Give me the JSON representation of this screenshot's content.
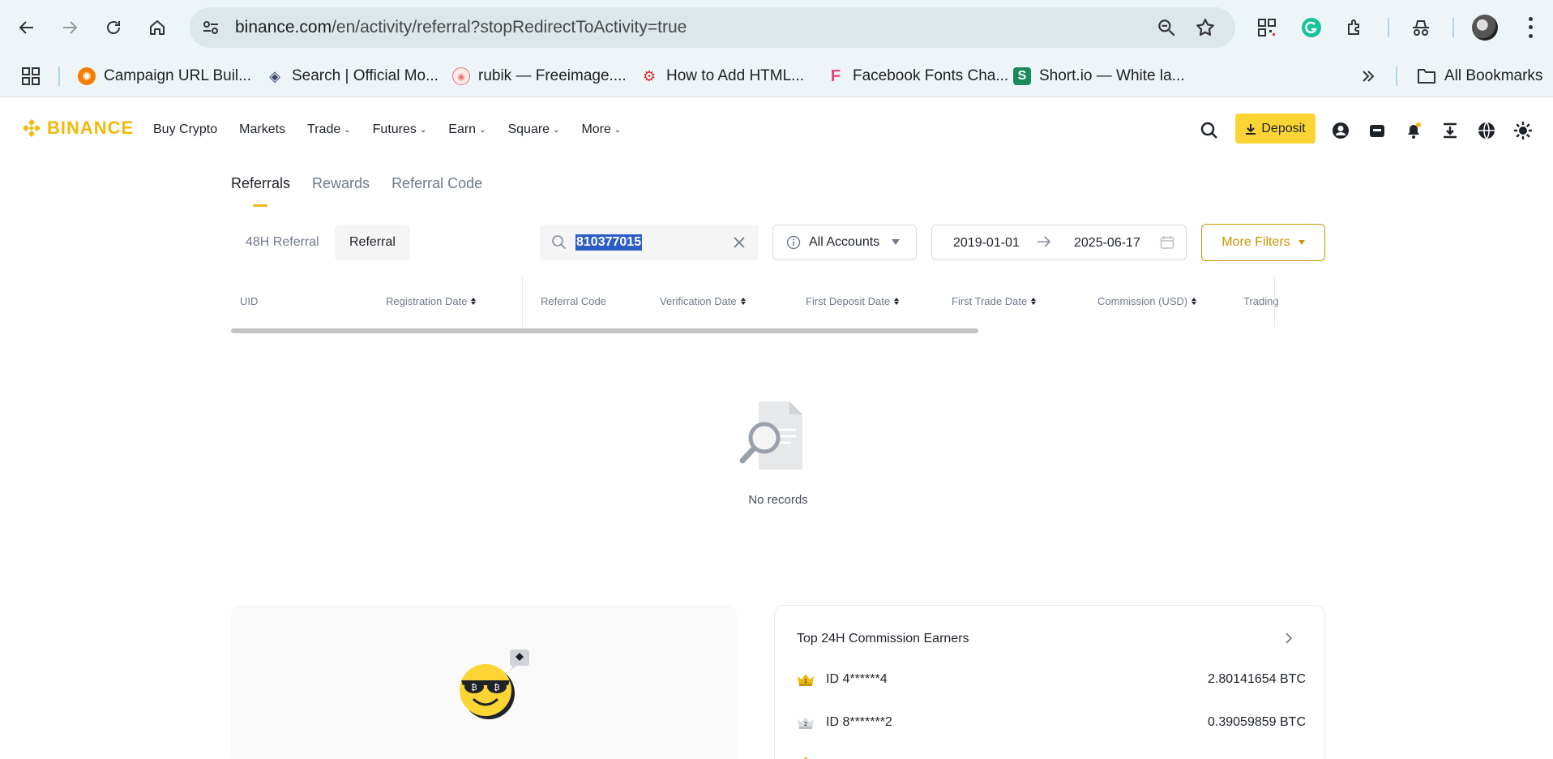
{
  "browser": {
    "url_host": "binance.com",
    "url_path": "/en/activity/referral?stopRedirectToActivity=true",
    "bookmarks": [
      {
        "label": "Campaign URL Buil...",
        "icon": "campaign-icon",
        "color": "#f57c00"
      },
      {
        "label": "Search | Official Mo...",
        "icon": "diamond-icon",
        "color": "#3c4a6e"
      },
      {
        "label": "rubik — Freeimage....",
        "icon": "rubik-icon",
        "color": "#e57373"
      },
      {
        "label": "How to Add HTML...",
        "icon": "gear-icon",
        "color": "#d32f2f"
      },
      {
        "label": "Facebook Fonts Cha...",
        "icon": "font-f-icon",
        "color": "#ec407a"
      },
      {
        "label": "Short.io — White la...",
        "icon": "short-s-icon",
        "color": "#1b8a5a"
      }
    ],
    "all_bookmarks_label": "All Bookmarks"
  },
  "header": {
    "logo_text": "BINANCE",
    "menu": [
      {
        "label": "Buy Crypto",
        "has_dropdown": false
      },
      {
        "label": "Markets",
        "has_dropdown": false
      },
      {
        "label": "Trade",
        "has_dropdown": true
      },
      {
        "label": "Futures",
        "has_dropdown": true
      },
      {
        "label": "Earn",
        "has_dropdown": true
      },
      {
        "label": "Square",
        "has_dropdown": true
      },
      {
        "label": "More",
        "has_dropdown": true
      }
    ],
    "deposit_label": "Deposit",
    "accent_color": "#fcd535",
    "brand_color": "#f0b90b"
  },
  "tabs": [
    {
      "label": "Referrals",
      "active": true
    },
    {
      "label": "Rewards",
      "active": false
    },
    {
      "label": "Referral Code",
      "active": false
    }
  ],
  "filters": {
    "seg_48h": "48H Referral",
    "seg_referral": "Referral",
    "search_value": "810377015",
    "account_select": "All Accounts",
    "date_from": "2019-01-01",
    "date_to": "2025-06-17",
    "more_filters_label": "More Filters"
  },
  "table": {
    "columns": [
      {
        "label": "UID",
        "sortable": false
      },
      {
        "label": "Registration Date",
        "sortable": true
      },
      {
        "label": "Referral Code",
        "sortable": false
      },
      {
        "label": "Verification Date",
        "sortable": true
      },
      {
        "label": "First Deposit Date",
        "sortable": true
      },
      {
        "label": "First Trade Date",
        "sortable": true
      },
      {
        "label": "Commission (USD)",
        "sortable": true
      },
      {
        "label": "Trading",
        "sortable": false
      }
    ],
    "empty_text": "No records"
  },
  "earners": {
    "title": "Top 24H Commission Earners",
    "rows": [
      {
        "rank": "1",
        "uid": "ID 4******4",
        "amount": "2.80141654 BTC"
      },
      {
        "rank": "2",
        "uid": "ID 8*******2",
        "amount": "0.39059859 BTC"
      }
    ]
  }
}
